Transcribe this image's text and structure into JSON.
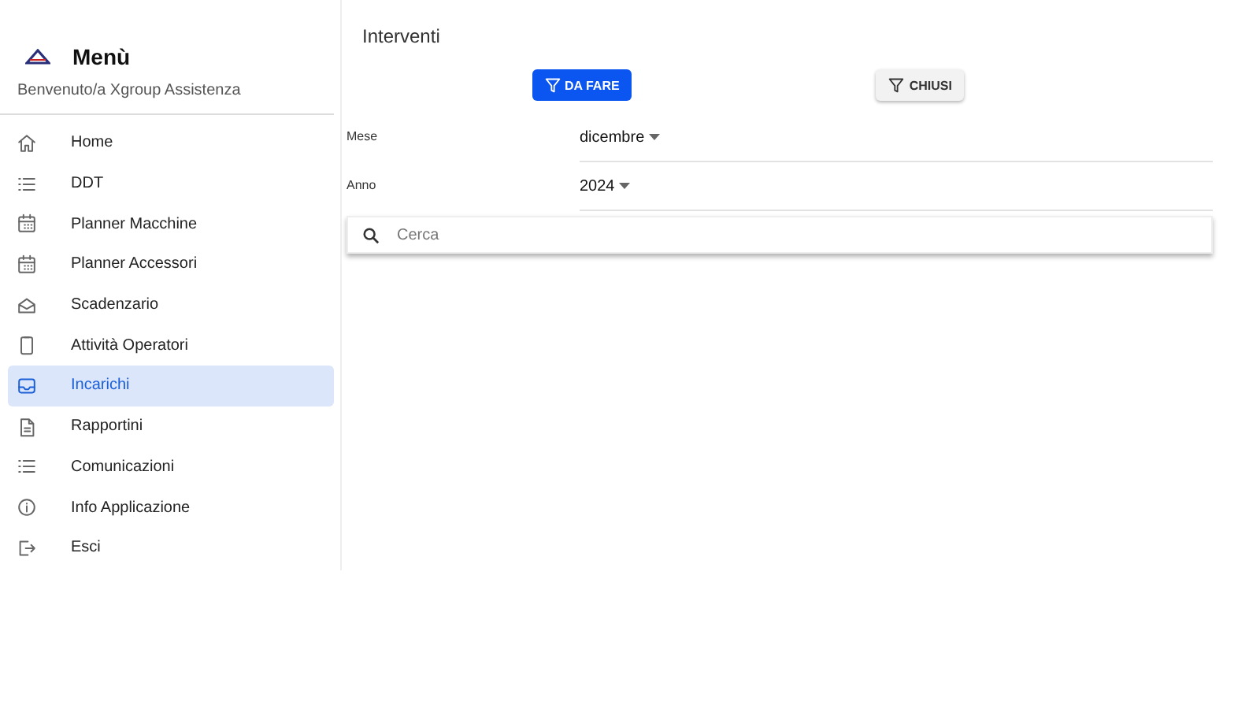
{
  "sidebar": {
    "title": "Menù",
    "subtitle": "Benvenuto/a Xgroup Assistenza",
    "items": [
      {
        "label": "Home",
        "selected": false
      },
      {
        "label": "DDT",
        "selected": false
      },
      {
        "label": "Planner Macchine",
        "selected": false
      },
      {
        "label": "Planner Accessori",
        "selected": false
      },
      {
        "label": "Scadenzario",
        "selected": false
      },
      {
        "label": "Attività Operatori",
        "selected": false
      },
      {
        "label": "Incarichi",
        "selected": true
      },
      {
        "label": "Rapportini",
        "selected": false
      },
      {
        "label": "Comunicazioni",
        "selected": false
      },
      {
        "label": "Info Applicazione",
        "selected": false
      },
      {
        "label": "Esci",
        "selected": false
      }
    ]
  },
  "main": {
    "title": "Interventi",
    "filters": [
      {
        "label": "DA FARE",
        "selected": true
      },
      {
        "label": "CHIUSI",
        "selected": false
      }
    ],
    "fields": [
      {
        "label": "Mese",
        "value": "dicembre"
      },
      {
        "label": "Anno",
        "value": "2024"
      }
    ],
    "search": {
      "placeholder": "Cerca"
    }
  }
}
